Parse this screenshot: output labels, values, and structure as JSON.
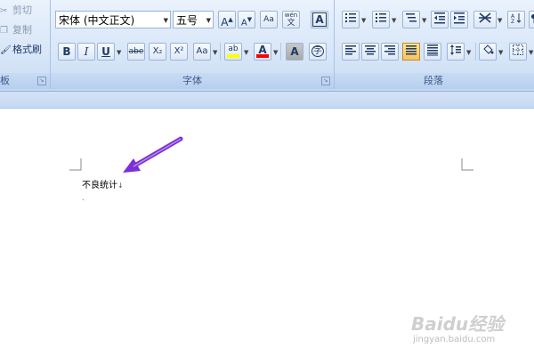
{
  "clipboard": {
    "cut_label": "剪切",
    "copy_label": "复制",
    "format_painter_label": "格式刷",
    "group_label_partial": "板"
  },
  "font_group": {
    "font_name": "宋体 (中文正文)",
    "font_size": "五号",
    "group_label": "字体",
    "buttons": {
      "grow": "A",
      "shrink": "A",
      "clear": "Aa",
      "phonetic": "wén",
      "phonetic_char": "文",
      "border": "A",
      "bold": "B",
      "italic": "I",
      "underline": "U",
      "strike": "abe",
      "subscript": "X₂",
      "superscript": "X²",
      "change_case": "Aa",
      "highlight": "ab",
      "font_color": "A",
      "shading": "A",
      "enclose": "字"
    }
  },
  "paragraph_group": {
    "group_label": "段落"
  },
  "document": {
    "line1": "不良统计",
    "line2": "."
  },
  "watermark": {
    "brand": "Baidu经验",
    "url": "jingyan.baidu.com"
  },
  "colors": {
    "highlight_yellow": "#ffff00",
    "font_red": "#ff0000",
    "annotation_arrow": "#7b2fd6"
  }
}
